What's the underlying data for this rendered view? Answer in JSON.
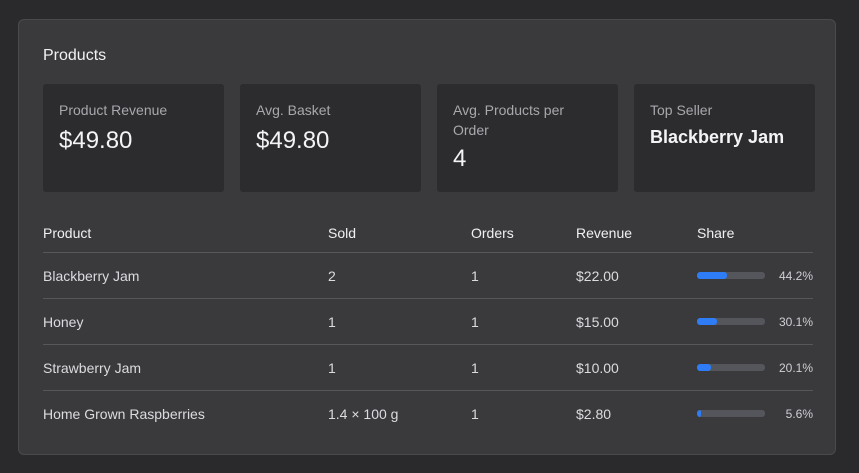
{
  "panel": {
    "title": "Products"
  },
  "cards": [
    {
      "label": "Product Revenue",
      "value": "$49.80"
    },
    {
      "label": "Avg. Basket",
      "value": "$49.80"
    },
    {
      "label": "Avg. Products per Order",
      "value": "4"
    },
    {
      "label": "Top Seller",
      "value": "Blackberry Jam"
    }
  ],
  "table": {
    "headers": {
      "product": "Product",
      "sold": "Sold",
      "orders": "Orders",
      "revenue": "Revenue",
      "share": "Share"
    },
    "rows": [
      {
        "product": "Blackberry Jam",
        "sold": "2",
        "orders": "1",
        "revenue": "$22.00",
        "share": "44.2%",
        "share_value": 0.442
      },
      {
        "product": "Honey",
        "sold": "1",
        "orders": "1",
        "revenue": "$15.00",
        "share": "30.1%",
        "share_value": 0.301
      },
      {
        "product": "Strawberry Jam",
        "sold": "1",
        "orders": "1",
        "revenue": "$10.00",
        "share": "20.1%",
        "share_value": 0.201
      },
      {
        "product": "Home Grown Raspberries",
        "sold": "1.4 × 100 g",
        "orders": "1",
        "revenue": "$2.80",
        "share": "5.6%",
        "share_value": 0.056
      }
    ]
  },
  "colors": {
    "page_background": "#2a2a2c",
    "panel_background": "#3a3a3d",
    "card_background": "#2c2c2e",
    "accent": "#2f7df6",
    "bar_track": "#55555c"
  }
}
